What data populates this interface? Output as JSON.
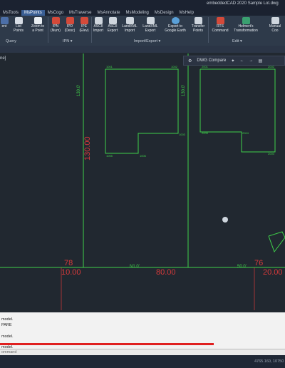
{
  "window": {
    "title": "embeddedCAD 2020    Sample Lot.dwg"
  },
  "tabs": [
    "MsTools",
    "MsPoints",
    "MsCogo",
    "MsTraverse",
    "MsAnnotate",
    "MsModeling",
    "MsDesign",
    "MsHelp"
  ],
  "active_tab": "MsPoints",
  "ribbon": {
    "buttons": [
      {
        "label": "ent"
      },
      {
        "label": "List\nPoints"
      },
      {
        "label": "Zoom to\na Point"
      },
      {
        "label": "IPN\n(Num)"
      },
      {
        "label": "IPD\n(Desc)"
      },
      {
        "label": "IPE\n(Elev)"
      },
      {
        "label": "ASCII\nImport"
      },
      {
        "label": "ASCII\nExport"
      },
      {
        "label": "LandXML\nImport"
      },
      {
        "label": "LandXML\nExport"
      },
      {
        "label": "Export to\nGoogle Earth"
      },
      {
        "label": "Transfer\nPoints"
      },
      {
        "label": "RTS\nCommand"
      },
      {
        "label": "Helmert's\nTransformation"
      },
      {
        "label": "Manual\nCoo"
      }
    ],
    "panels": [
      "Query",
      "IPN ▾",
      "Import/Export ▾",
      "Edit ▾"
    ]
  },
  "viewport": {
    "label": "ne]",
    "dwg_compare": "DWG Compare",
    "dimensions": {
      "left_side": "130.00",
      "top_left": "130.0'",
      "top_mid": "130.0'",
      "bottom_left": "10.00",
      "bottom_mid": "80.00",
      "bottom_right": "20.00",
      "marker_left": "78",
      "marker_right": "76",
      "bearing_mid": "N1.0'",
      "bearing_right": "50.0'"
    }
  },
  "command": {
    "lines": [
      "model.",
      "PARE",
      "model.",
      "model."
    ],
    "prompt": "ommand"
  },
  "status": {
    "coordinates": "4765.160, 10750"
  },
  "colors": {
    "accent": "#3a5f95",
    "linework": "#3fd04a",
    "dimension": "#d83a3a",
    "command_bar": "#e02020"
  }
}
